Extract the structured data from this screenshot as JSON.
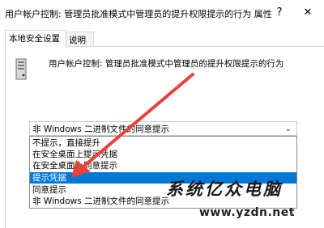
{
  "window": {
    "title": "用户帐户控制: 管理员批准模式中管理员的提升权限提示的行为 属性",
    "help_label": "?",
    "close_label": "✕"
  },
  "tabs": [
    {
      "label": "本地安全设置",
      "active": true
    },
    {
      "label": "说明",
      "active": false
    }
  ],
  "policy": {
    "description": "用户帐户控制: 管理员批准模式中管理员的提升权限提示的行为",
    "icon": "server-policy-icon"
  },
  "combo": {
    "value": "非 Windows 二进制文件的同意提示",
    "arrow": "⌄",
    "options": [
      {
        "label": "不提示，直接提升",
        "selected": false
      },
      {
        "label": "在安全桌面上提示凭据",
        "selected": false
      },
      {
        "label": "在安全桌面上同意提示",
        "selected": false
      },
      {
        "label": "提示凭据",
        "selected": true
      },
      {
        "label": "同意提示",
        "selected": false
      },
      {
        "label": "非 Windows 二进制文件的同意提示",
        "selected": false
      }
    ]
  },
  "watermark": {
    "brand": "系统亿众电脑",
    "url": "www.yzdn.net"
  },
  "colors": {
    "selection": "#0078d7",
    "annotation_arrow": "#e8413c"
  }
}
